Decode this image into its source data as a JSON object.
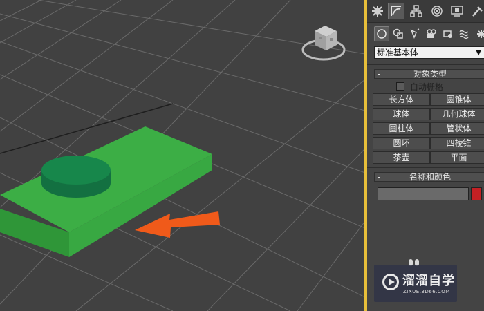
{
  "viewport": {
    "view_cube_icon": "view-cube-icon",
    "objects": [
      "green-box",
      "green-cylinder"
    ],
    "arrow_icon": "orange-arrow-icon",
    "colors": {
      "background": "#414141",
      "grid": "#6a6a6a",
      "box": "#3cae45",
      "cylinder": "#17874b",
      "arrow": "#f05a1a",
      "border": "#e8bf3a"
    }
  },
  "panel": {
    "tabs": [
      {
        "icon": "create-tab-icon"
      },
      {
        "icon": "modify-tab-icon"
      },
      {
        "icon": "hierarchy-tab-icon"
      },
      {
        "icon": "motion-tab-icon"
      },
      {
        "icon": "display-tab-icon"
      },
      {
        "icon": "utilities-tab-icon"
      }
    ],
    "subtabs": [
      {
        "icon": "geometry-icon"
      },
      {
        "icon": "shapes-icon"
      },
      {
        "icon": "lights-icon"
      },
      {
        "icon": "cameras-icon"
      },
      {
        "icon": "helpers-icon"
      },
      {
        "icon": "spacewarps-icon"
      },
      {
        "icon": "systems-icon"
      }
    ],
    "category_select": "标准基本体",
    "object_type": {
      "toggle": "-",
      "title": "对象类型",
      "autogrid_label": "自动栅格",
      "autogrid_checked": false,
      "buttons": [
        "长方体",
        "圆锥体",
        "球体",
        "几何球体",
        "圆柱体",
        "管状体",
        "圆环",
        "四棱锥",
        "茶壶",
        "平面"
      ]
    },
    "name_color": {
      "toggle": "-",
      "title": "名称和颜色",
      "name_value": "",
      "swatch_color": "#c42024"
    }
  },
  "watermark": {
    "title": "溜溜自学",
    "subtitle": "ZIXUE.3D66.COM"
  }
}
